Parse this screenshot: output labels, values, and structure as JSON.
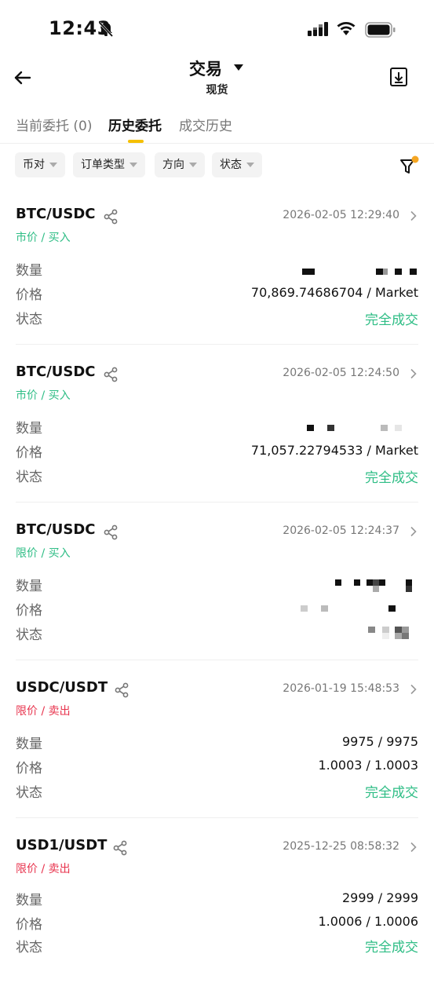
{
  "status_bar": {
    "time": "12:43"
  },
  "header": {
    "title": "交易",
    "subtitle": "现货"
  },
  "tabs": [
    {
      "label": "当前委托 (0)",
      "active": false
    },
    {
      "label": "历史委托",
      "active": true
    },
    {
      "label": "成交历史",
      "active": false
    }
  ],
  "filters": [
    {
      "label": "币对"
    },
    {
      "label": "订单类型"
    },
    {
      "label": "方向"
    },
    {
      "label": "状态"
    }
  ],
  "labels": {
    "qty": "数量",
    "price": "价格",
    "status": "状态"
  },
  "orders": [
    {
      "pair": "BTC/USDC",
      "type": "市价 / 买入",
      "date": "2026-02-05 12:29:40",
      "qty": "",
      "price": "70,869.74686704 / Market",
      "status": "完全成交"
    },
    {
      "pair": "BTC/USDC",
      "type": "市价 / 买入",
      "date": "2026-02-05 12:24:50",
      "qty": "",
      "price": "71,057.22794533 / Market",
      "status": "完全成交"
    },
    {
      "pair": "BTC/USDC",
      "type": "限价 / 买入",
      "date": "2026-02-05 12:24:37",
      "qty": "",
      "price": "",
      "status": ""
    },
    {
      "pair": "USDC/USDT",
      "type": "限价 / 卖出",
      "date": "2026-01-19 15:48:53",
      "qty": "9975 / 9975",
      "price": "1.0003 / 1.0003",
      "status": "完全成交"
    },
    {
      "pair": "USD1/USDT",
      "type": "限价 / 卖出",
      "date": "2025-12-25 08:58:32",
      "qty": "2999 / 2999",
      "price": "1.0006 / 1.0006",
      "status": "完全成交"
    }
  ],
  "colors": {
    "accent": "#f5c000",
    "buy": "#2ebd85",
    "sell": "#e8344e",
    "filter_dot": "#f5a623"
  },
  "icons": [
    "bell-off-icon",
    "signal-icon",
    "wifi-icon",
    "battery-icon",
    "back-arrow-icon",
    "caret-down-icon",
    "download-icon",
    "filter-icon",
    "share-icon",
    "chevron-right-icon"
  ]
}
